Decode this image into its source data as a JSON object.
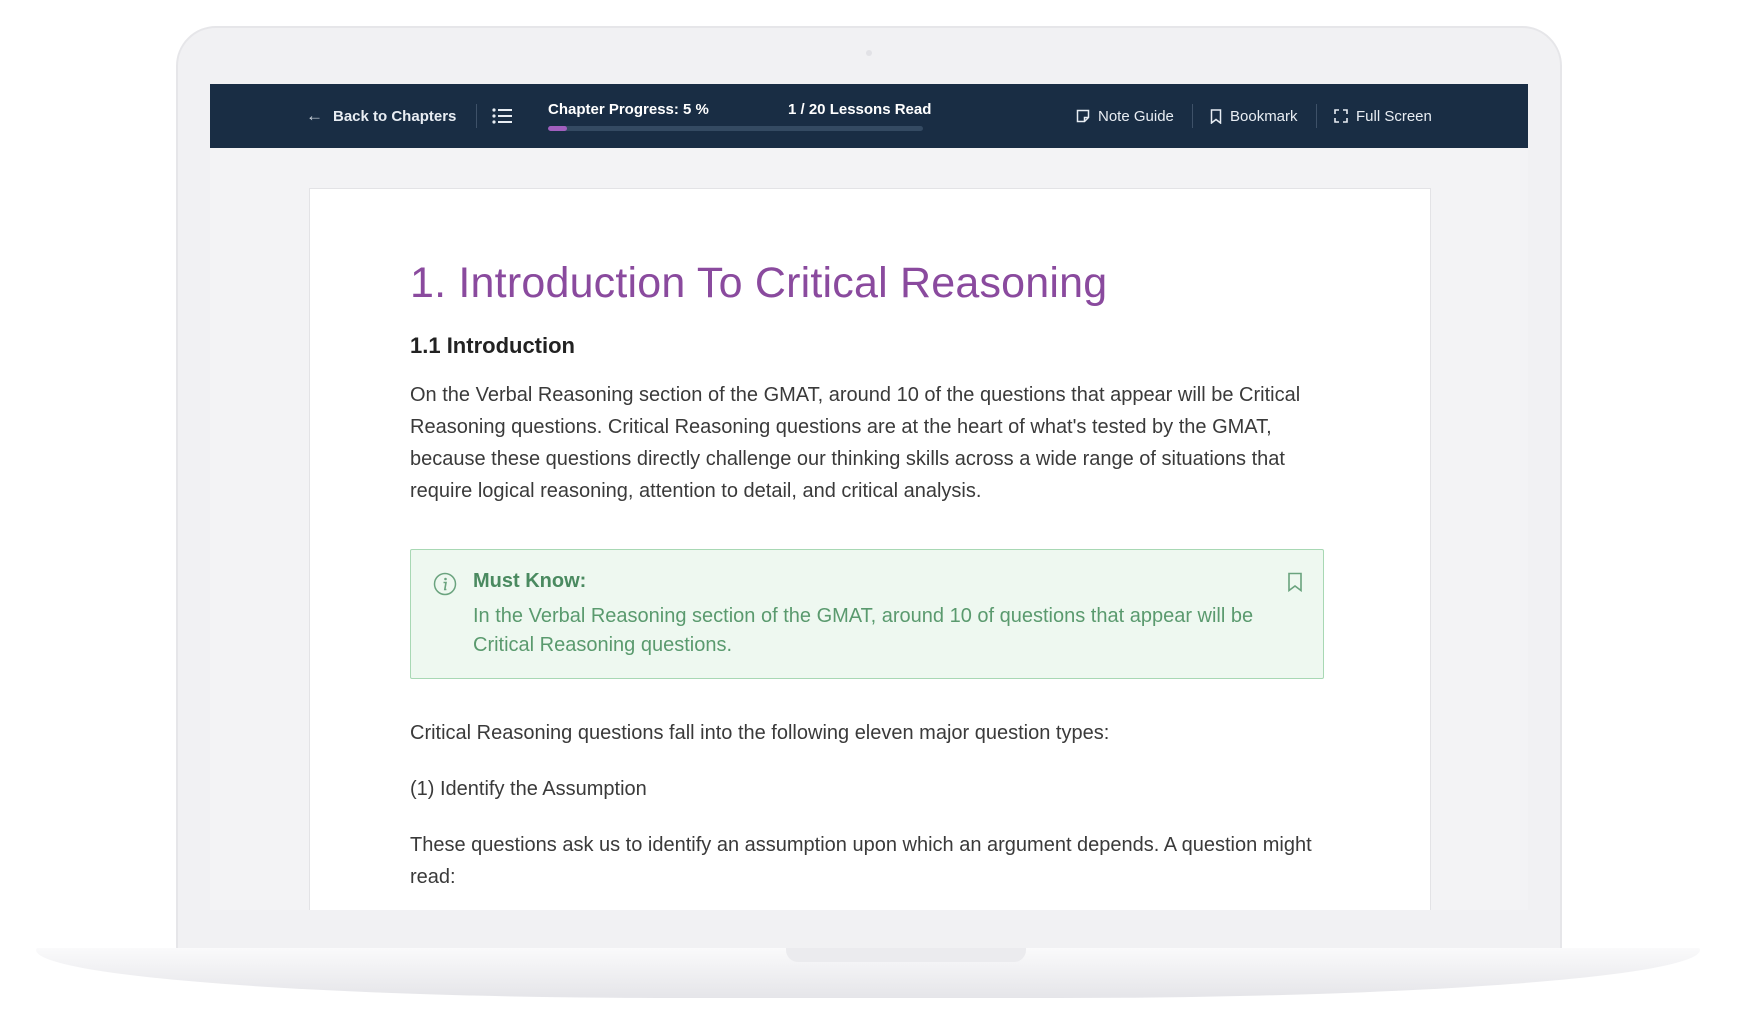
{
  "topbar": {
    "back_label": "Back to Chapters",
    "progress_label": "Chapter Progress: 5 %",
    "progress_fraction": 0.05,
    "lessons_label": "1 / 20 Lessons Read",
    "note_label": "Note Guide",
    "bookmark_label": "Bookmark",
    "fullscreen_label": "Full Screen"
  },
  "content": {
    "chapter_title": "1. Introduction To Critical Reasoning",
    "section_title": "1.1 Introduction",
    "paragraph_1": "On the Verbal Reasoning section of the GMAT, around 10 of the questions that appear will be Critical Reasoning questions. Critical Reasoning questions are at the heart of what's tested by the GMAT, because these questions directly challenge our thinking skills across a wide range of situations that require logical reasoning, attention to detail, and critical analysis.",
    "must_know": {
      "title": "Must Know:",
      "text": "In the Verbal Reasoning section of the GMAT, around 10 of questions that appear will be Critical Reasoning questions."
    },
    "paragraph_2": "Critical Reasoning questions fall into the following eleven major question types:",
    "paragraph_3": "(1) Identify the Assumption",
    "paragraph_4": "These questions ask us to identify an assumption upon which an argument depends. A question might read:"
  },
  "colors": {
    "topbar_bg": "#192d44",
    "progress_fill": "#a15fbe",
    "title_purple": "#8a4a9e",
    "mustknow_green": "#4a8a60"
  }
}
